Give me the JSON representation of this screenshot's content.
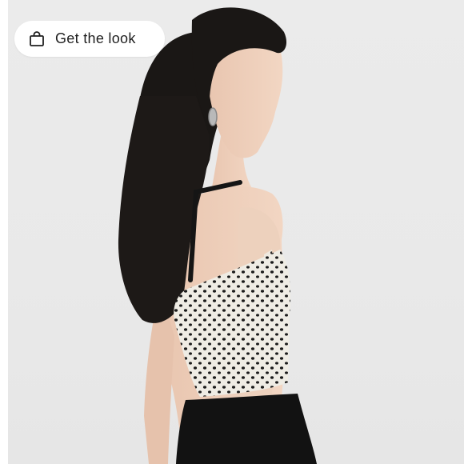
{
  "image": {
    "alt_subject": "model-side-profile",
    "icon": "shopping-bag-icon"
  },
  "cta": {
    "label": "Get the look",
    "icon": "shopping-bag-icon"
  },
  "colors": {
    "background": "#e9e9e9",
    "button_bg": "#ffffff",
    "button_text": "#1f1f1f"
  }
}
